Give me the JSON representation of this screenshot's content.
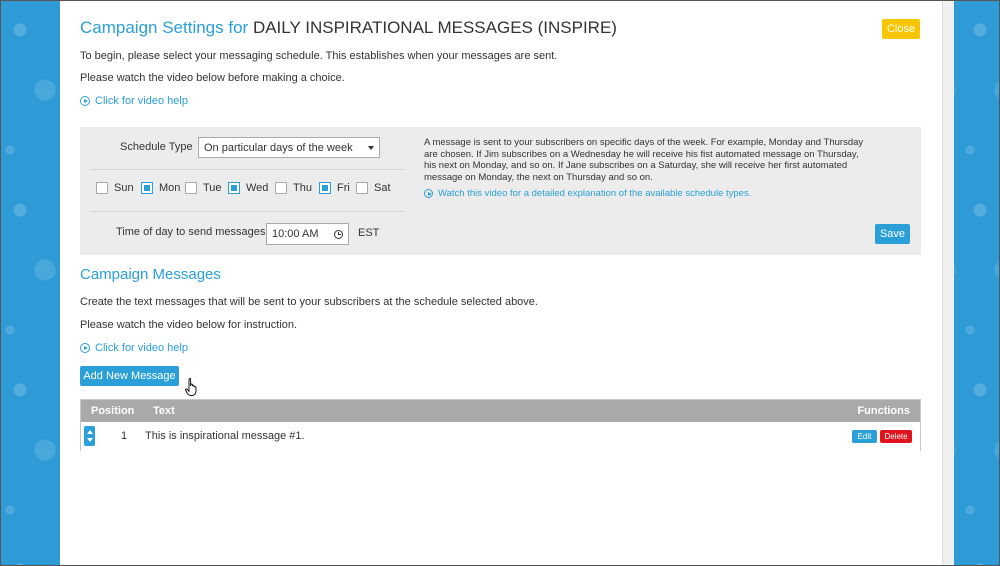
{
  "header": {
    "title_prefix": "Campaign Settings for",
    "campaign_name": "DAILY INSPIRATIONAL MESSAGES (INSPIRE)",
    "close_label": "Close"
  },
  "intro": {
    "line1": "To begin, please select your messaging schedule. This establishes when your messages are sent.",
    "line2": "Please watch the video below before making a choice.",
    "video_link": "Click for video help"
  },
  "schedule": {
    "type_label": "Schedule Type",
    "type_value": "On particular days of the week",
    "days": [
      {
        "label": "Sun",
        "checked": false
      },
      {
        "label": "Mon",
        "checked": true
      },
      {
        "label": "Tue",
        "checked": false
      },
      {
        "label": "Wed",
        "checked": true
      },
      {
        "label": "Thu",
        "checked": false
      },
      {
        "label": "Fri",
        "checked": true
      },
      {
        "label": "Sat",
        "checked": false
      }
    ],
    "time_label": "Time of day to send messages",
    "time_value": "10:00 AM",
    "timezone": "EST",
    "description": "A message is sent to your subscribers on specific days of the week. For example, Monday and Thursday are chosen. If Jim subscribes on a Wednesday he will receive his fist automated message on Thursday, his next on Monday, and so on. If Jane subscribes on a Saturday, she will receive her first automated message on Monday, the next on Thursday and so on.",
    "video_link": "Watch this video for a detailed explanation of the available schedule types.",
    "save_label": "Save"
  },
  "messages": {
    "heading": "Campaign Messages",
    "line1": "Create the text messages that will be sent to your subscribers at the schedule selected above.",
    "line2": "Please watch the video below for instruction.",
    "video_link": "Click for video help",
    "add_label": "Add New Message",
    "columns": {
      "position": "Position",
      "text": "Text",
      "functions": "Functions"
    },
    "rows": [
      {
        "position": "1",
        "text": "This is inspirational message #1.",
        "edit": "Edit",
        "delete": "Delete"
      }
    ]
  },
  "colors": {
    "accent": "#2a9fd8",
    "close": "#f7c600",
    "delete": "#e0141e",
    "background": "#2f9bd6"
  }
}
